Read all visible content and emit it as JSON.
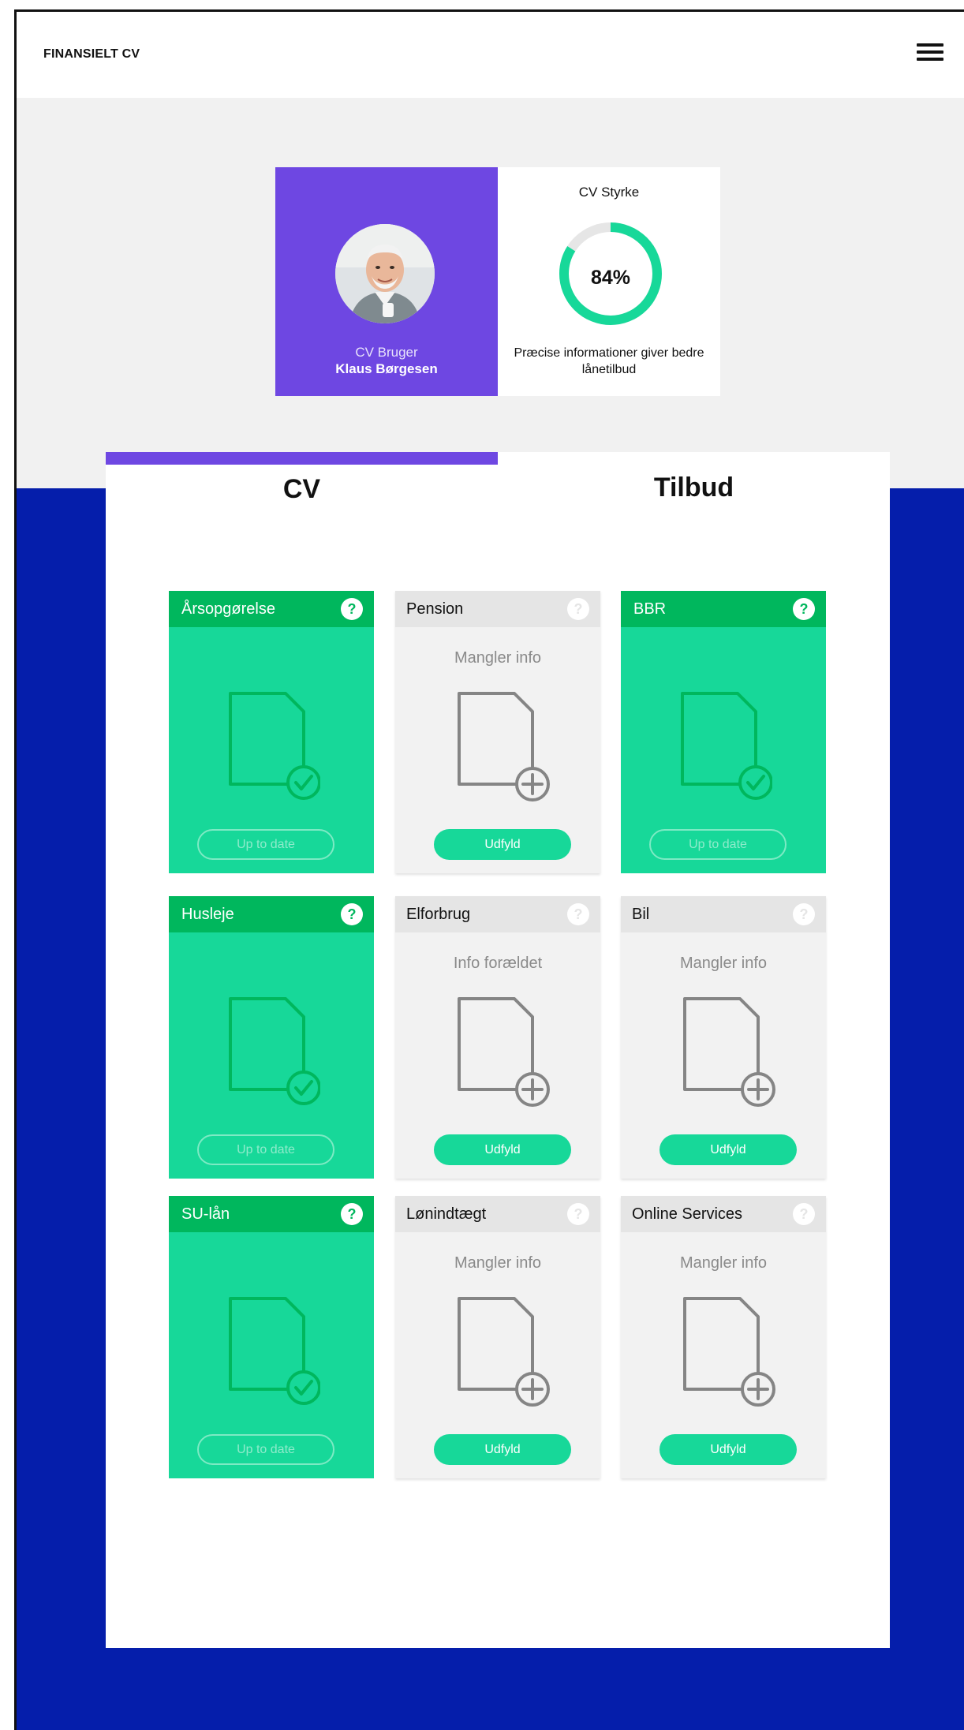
{
  "header": {
    "brand": "FINANSIELT CV"
  },
  "profile": {
    "role_label": "CV Bruger",
    "name": "Klaus Børgesen"
  },
  "strength": {
    "title": "CV Styrke",
    "percent": 84,
    "percent_label": "84%",
    "description": "Præcise informationer giver bedre lånetilbud"
  },
  "tabs": [
    {
      "label": "CV",
      "active": true
    },
    {
      "label": "Tilbud",
      "active": false
    }
  ],
  "cards": [
    {
      "title": "Årsopgørelse",
      "state": "green",
      "status": "",
      "action": "Up to date"
    },
    {
      "title": "Pension",
      "state": "gray",
      "status": "Mangler info",
      "action": "Udfyld"
    },
    {
      "title": "BBR",
      "state": "green",
      "status": "",
      "action": "Up to date"
    },
    {
      "title": "Husleje",
      "state": "green",
      "status": "",
      "action": "Up to date"
    },
    {
      "title": "Elforbrug",
      "state": "gray",
      "status": "Info forældet",
      "action": "Udfyld"
    },
    {
      "title": "Bil",
      "state": "gray",
      "status": "Mangler info",
      "action": "Udfyld"
    },
    {
      "title": "SU-lån",
      "state": "green",
      "status": "",
      "action": "Up to date"
    },
    {
      "title": "Lønindtægt",
      "state": "gray",
      "status": "Mangler info",
      "action": "Udfyld"
    },
    {
      "title": "Online Services",
      "state": "gray",
      "status": "Mangler info",
      "action": "Udfyld"
    }
  ],
  "help_symbol": "?",
  "colors": {
    "purple": "#6e47e2",
    "green": "#17d899",
    "dark_green": "#00b75d",
    "blue": "#051eab"
  }
}
